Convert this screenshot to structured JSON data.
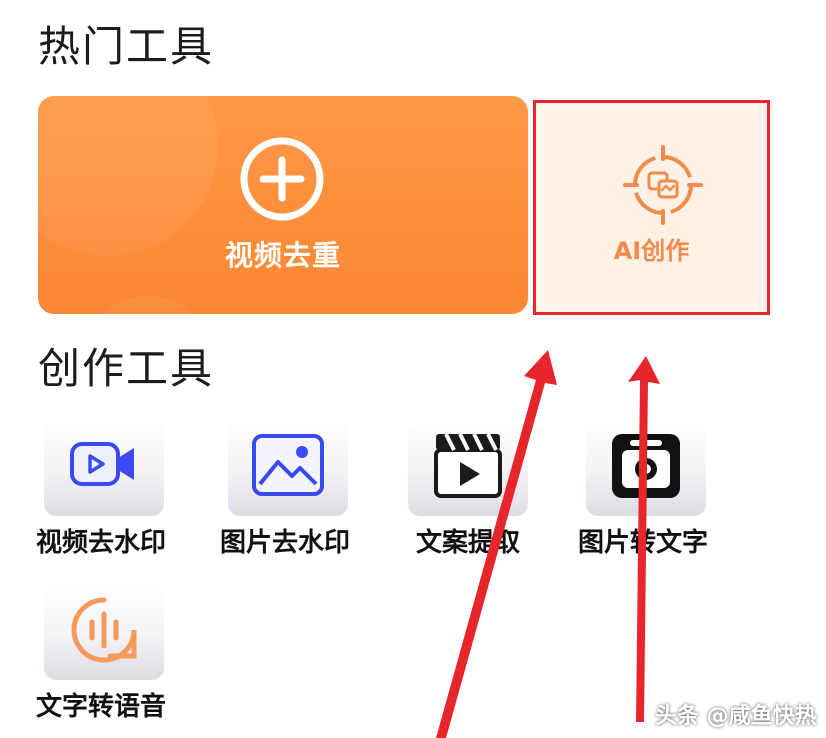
{
  "sections": {
    "hot_tools_title": "热门工具",
    "creation_tools_title": "创作工具"
  },
  "hot_tools": {
    "video_dedupe": {
      "label": "视频去重",
      "icon": "plus-circle-icon",
      "color": "#fc8734"
    },
    "ai_create": {
      "label": "AI创作",
      "icon": "ai-target-icon",
      "color": "#f08b4b"
    }
  },
  "creation_tools": [
    {
      "label": "视频去水印",
      "icon": "video-camera-icon"
    },
    {
      "label": "图片去水印",
      "icon": "image-icon"
    },
    {
      "label": "文案提取",
      "icon": "clapperboard-icon"
    },
    {
      "label": "图片转文字",
      "icon": "camera-scan-icon"
    },
    {
      "label": "文字转语音",
      "icon": "voice-wave-icon"
    }
  ],
  "annotation": {
    "highlight_color": "#e6262b"
  },
  "watermark": "头条 @咸鱼快热"
}
